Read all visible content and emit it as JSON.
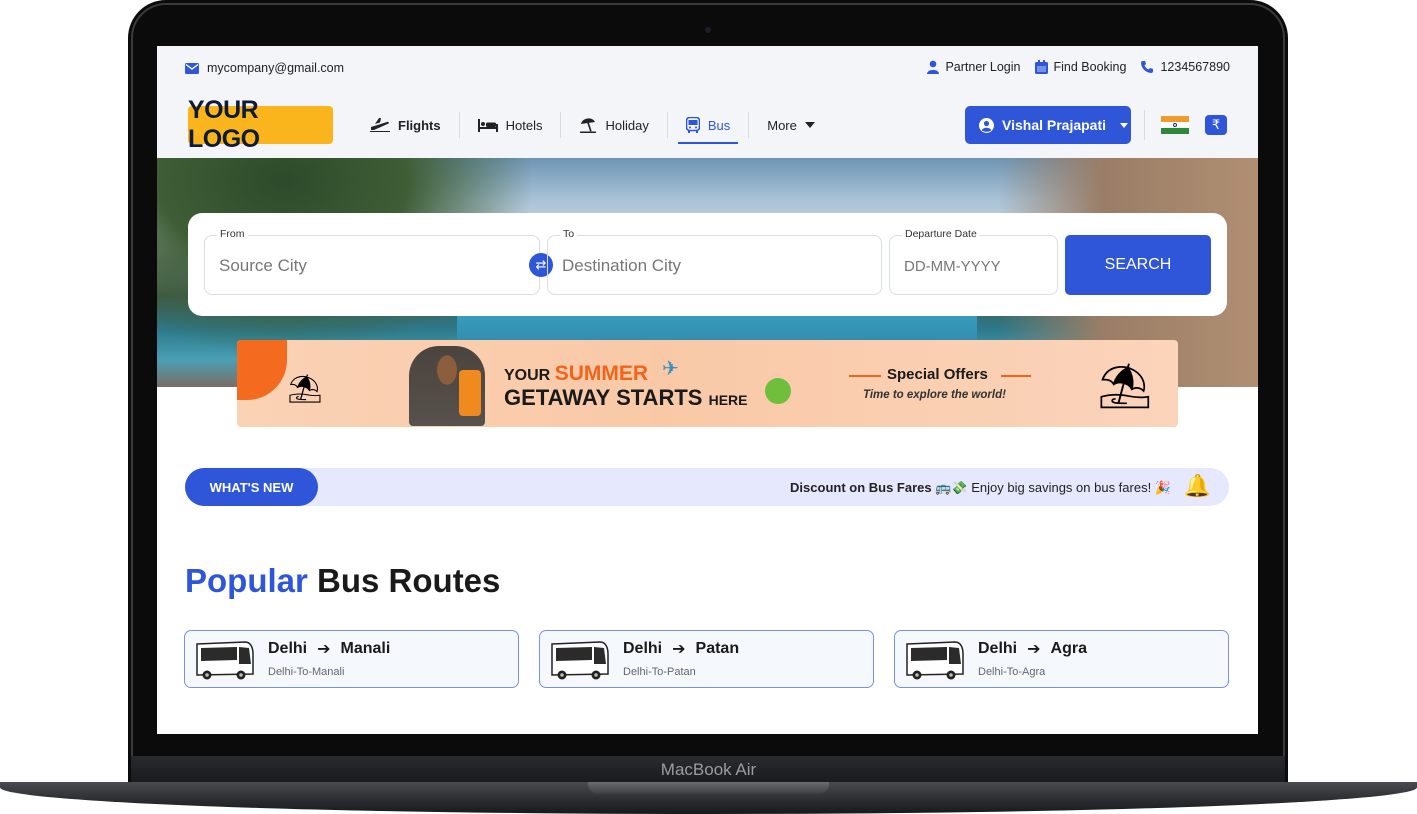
{
  "device": {
    "label": "MacBook Air"
  },
  "topbar": {
    "email": "mycompany@gmail.com",
    "partner_login": "Partner Login",
    "find_booking": "Find Booking",
    "phone": "1234567890"
  },
  "nav": {
    "logo": "YOUR LOGO",
    "items": [
      {
        "label": "Flights",
        "icon": "plane-icon"
      },
      {
        "label": "Hotels",
        "icon": "bed-icon"
      },
      {
        "label": "Holiday",
        "icon": "beach-umbrella-icon"
      },
      {
        "label": "Bus",
        "icon": "bus-icon",
        "active": true
      },
      {
        "label": "More",
        "icon": "chevron-down-icon"
      }
    ],
    "user_name": "Vishal Prajapati",
    "currency_symbol": "₹"
  },
  "search": {
    "from_label": "From",
    "from_placeholder": "Source City",
    "to_label": "To",
    "to_placeholder": "Destination City",
    "date_label": "Departure Date",
    "date_placeholder": "DD-MM-YYYY",
    "button": "SEARCH"
  },
  "promo": {
    "line1_prefix": "YOUR",
    "line1_highlight": "SUMMER",
    "line2": "GETAWAY STARTS",
    "line2_suffix": "HERE",
    "special_offers": "Special Offers",
    "tagline": "Time to explore the world!"
  },
  "whats_new": {
    "button": "WHAT'S NEW",
    "headline": "Discount on Bus Fares",
    "message": "Enjoy big savings on bus fares!"
  },
  "popular": {
    "title_accent": "Popular",
    "title_rest": "Bus Routes",
    "routes": [
      {
        "from": "Delhi",
        "to": "Manali",
        "slug": "Delhi-To-Manali"
      },
      {
        "from": "Delhi",
        "to": "Patan",
        "slug": "Delhi-To-Patan"
      },
      {
        "from": "Delhi",
        "to": "Agra",
        "slug": "Delhi-To-Agra"
      }
    ]
  },
  "colors": {
    "accent": "#2f56d9",
    "logo_bg": "#f9b51b",
    "news_bg": "#e6e8fd",
    "promo_orange": "#f0651b"
  }
}
